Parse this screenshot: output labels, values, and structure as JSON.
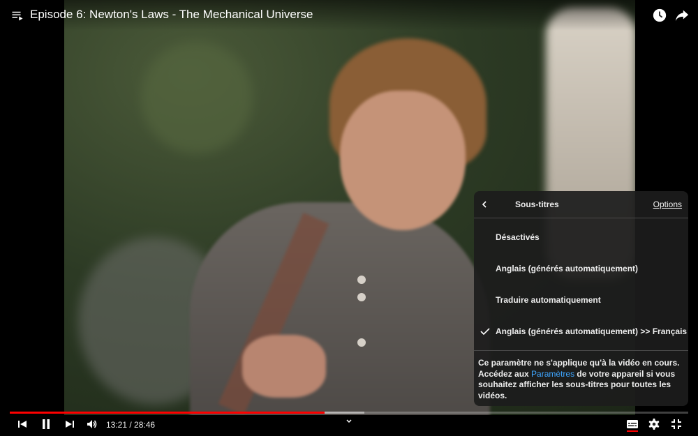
{
  "header": {
    "title": "Episode 6: Newton's Laws - The Mechanical Universe",
    "icons": [
      "playlist-icon",
      "watch-later-icon",
      "share-icon"
    ]
  },
  "subtitles_menu": {
    "title": "Sous-titres",
    "options_link": "Options",
    "items": [
      {
        "label": "Désactivés",
        "selected": false
      },
      {
        "label": "Anglais (générés automatiquement)",
        "selected": false
      },
      {
        "label": "Traduire automatiquement",
        "selected": false
      },
      {
        "label": "Anglais (générés automatiquement) >> Français",
        "selected": true
      }
    ],
    "note_before": "Ce paramètre ne s'applique qu'à la vidéo en cours. Accédez aux ",
    "note_link": "Paramètres",
    "note_after": " de votre appareil si vous souhaitez afficher les sous-titres pour toutes les vidéos."
  },
  "player": {
    "time_display": "13:21 / 28:46",
    "progress_fraction": 0.464,
    "buffered_fraction": 0.523,
    "accent_color": "#ff0000",
    "link_color": "#3ea6ff"
  }
}
